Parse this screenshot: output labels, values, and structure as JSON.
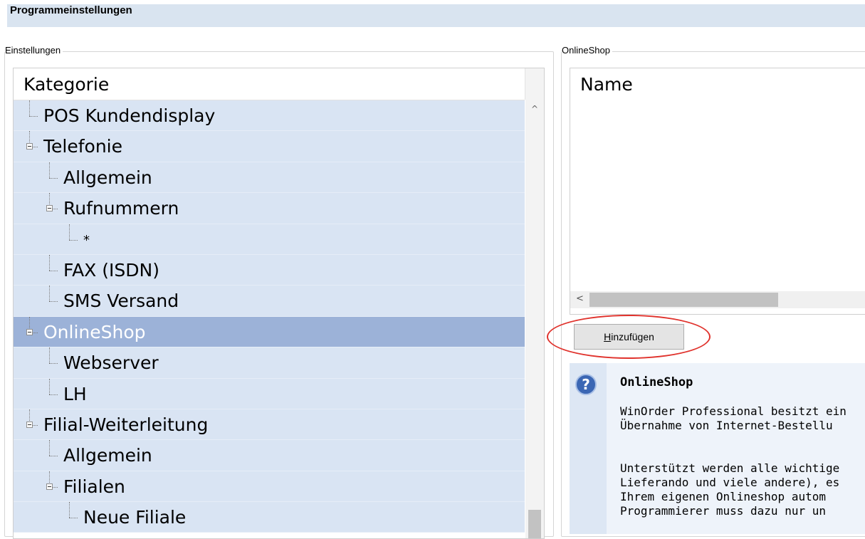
{
  "window": {
    "title": "Programmeinstellungen"
  },
  "left_group": {
    "legend": "Einstellungen",
    "header": "Kategorie",
    "tree": [
      {
        "label": "POS Kundendisplay",
        "level": 0,
        "expander": false,
        "selected": false
      },
      {
        "label": "Telefonie",
        "level": 0,
        "expander": true,
        "selected": false
      },
      {
        "label": "Allgemein",
        "level": 1,
        "expander": false,
        "selected": false
      },
      {
        "label": "Rufnummern",
        "level": 1,
        "expander": true,
        "selected": false
      },
      {
        "label": "*",
        "level": 2,
        "expander": false,
        "selected": false
      },
      {
        "label": "FAX (ISDN)",
        "level": 1,
        "expander": false,
        "selected": false
      },
      {
        "label": "SMS Versand",
        "level": 1,
        "expander": false,
        "selected": false
      },
      {
        "label": "OnlineShop",
        "level": 0,
        "expander": true,
        "selected": true
      },
      {
        "label": "Webserver",
        "level": 1,
        "expander": false,
        "selected": false
      },
      {
        "label": "LH",
        "level": 1,
        "expander": false,
        "selected": false
      },
      {
        "label": "Filial-Weiterleitung",
        "level": 0,
        "expander": true,
        "selected": false
      },
      {
        "label": "Allgemein",
        "level": 1,
        "expander": false,
        "selected": false
      },
      {
        "label": "Filialen",
        "level": 1,
        "expander": true,
        "selected": false
      },
      {
        "label": "Neue Filiale",
        "level": 2,
        "expander": false,
        "selected": false
      }
    ]
  },
  "right_group": {
    "legend": "OnlineShop",
    "list_header": "Name",
    "add_button": {
      "pre": "",
      "accel": "H",
      "post": "inzufügen"
    },
    "help": {
      "icon": "question-icon",
      "title": "OnlineShop",
      "para1": "WinOrder Professional besitzt ein\nÜbernahme von Internet-Bestellu",
      "para2": "Unterstützt werden alle wichtige\nLieferando und viele andere), es\nIhrem eigenen Onlineshop autom\nProgrammierer muss dazu nur un"
    }
  },
  "colors": {
    "row_bg": "#d9e4f3",
    "row_selected": "#9cb2d8",
    "annotation": "#e0322c"
  }
}
